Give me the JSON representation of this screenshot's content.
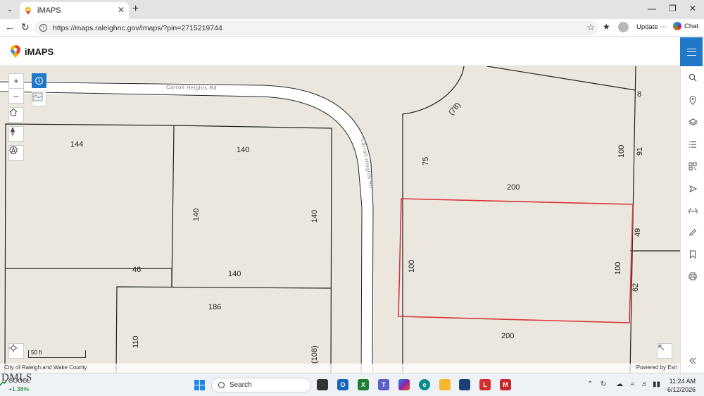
{
  "browser": {
    "tab_title": "iMAPS",
    "url": "https://maps.raleighnc.gov/imaps/?pin=2715219744",
    "update_label": "Update",
    "chat_label": "Chat"
  },
  "app": {
    "title": "iMAPS"
  },
  "map": {
    "road_name": "Carroll Heights Rd",
    "scale_label": "50 ft",
    "attribution_left": "City of Raleigh and Wake County",
    "attribution_right": "Powered by Esri",
    "dimensions": {
      "lot_top_left_width": "144",
      "lot_top_middle_width": "140",
      "lot_middle_left_side": "140",
      "lot_middle_right_side": "140",
      "lot_middle_bottom": "140",
      "lot_left_short": "46",
      "lot_bottom_width": "186",
      "lot_bottom_left_side": "110",
      "lot_bottom_right_side": "(108)",
      "lot_curve_edge": "(78)",
      "lot_upper_right_left_side": "75",
      "lot_upper_right_width": "200",
      "lot_upper_right_right_side": "100",
      "street_frontage_upper": "8",
      "street_frontage_mid": "91",
      "subject_left_side": "100",
      "subject_right_side": "100",
      "subject_frontage_upper": "49",
      "subject_frontage_lower": "62",
      "lower_right_width": "200"
    }
  },
  "taskbar": {
    "stock_name": "GOOGL",
    "stock_change": "+1.38%",
    "search_label": "Search",
    "time": "11:24 AM",
    "date": "6/12/2026",
    "watermark": "DMLS"
  },
  "colors": {
    "header_blue": "#1f78c8",
    "subject_parcel_outline": "#d9363e",
    "map_background": "#ebe7df"
  }
}
